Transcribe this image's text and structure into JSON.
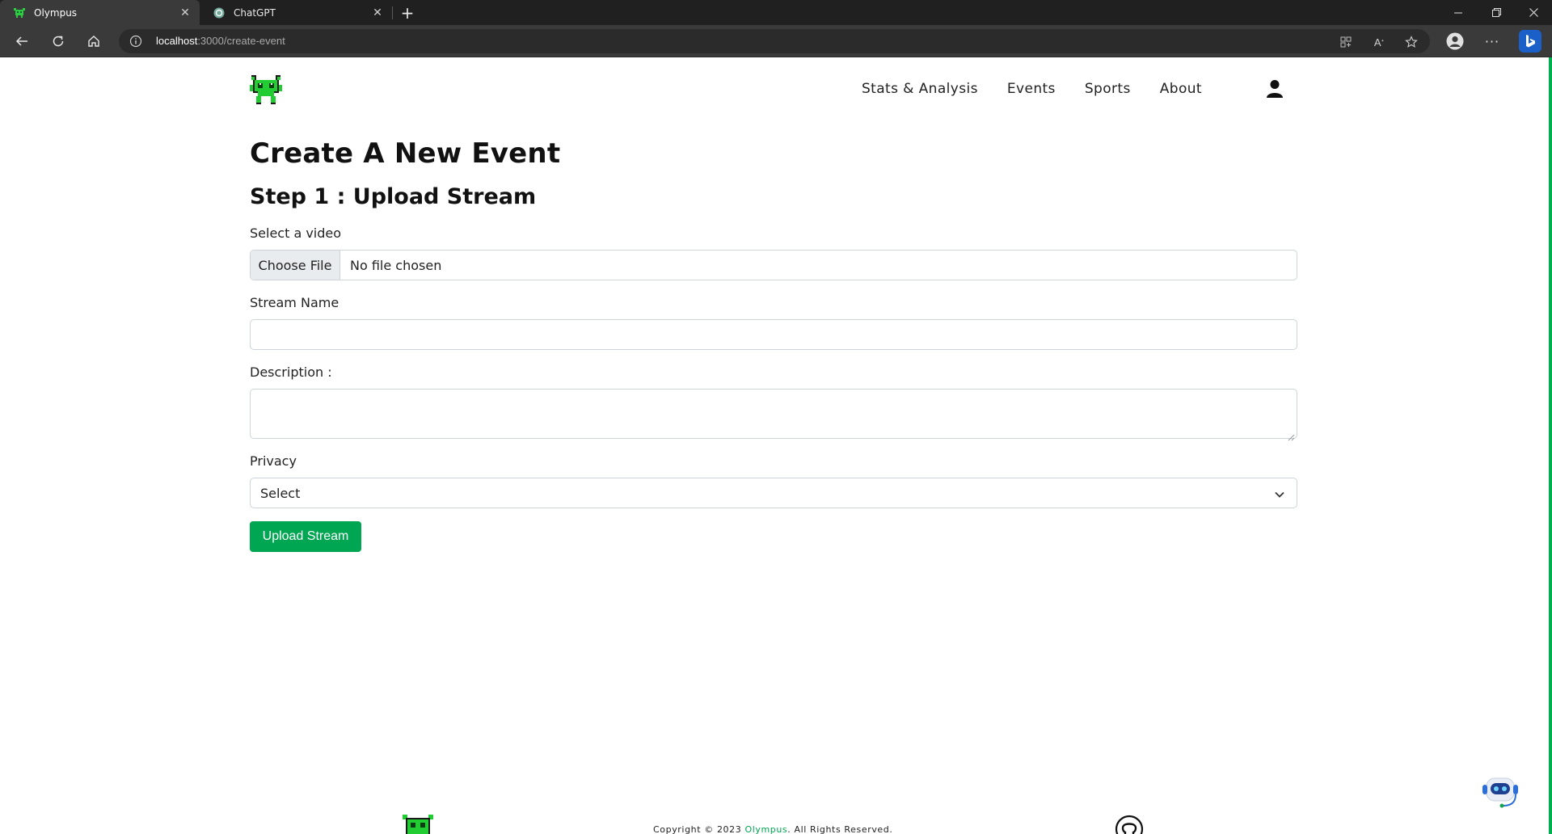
{
  "browser": {
    "tabs": [
      {
        "title": "Olympus",
        "active": true,
        "icon": "olympus-icon"
      },
      {
        "title": "ChatGPT",
        "active": false,
        "icon": "chatgpt-icon"
      }
    ],
    "url_host": "localhost",
    "url_rest": ":3000/create-event"
  },
  "nav": {
    "links": [
      "Stats & Analysis",
      "Events",
      "Sports",
      "About"
    ],
    "user_icon": "user-icon"
  },
  "page": {
    "title": "Create A New Event",
    "step_title": "Step 1 : Upload Stream",
    "video_label": "Select a video",
    "choose_file_label": "Choose File",
    "file_status": "No file chosen",
    "stream_name_label": "Stream Name",
    "stream_name_value": "",
    "description_label": "Description :",
    "description_value": "",
    "privacy_label": "Privacy",
    "privacy_selected": "Select",
    "submit_label": "Upload Stream"
  },
  "footer": {
    "copyright_prefix": "Copyright © 2023 ",
    "brand": "Olympus",
    "copyright_suffix": ". All Rights Reserved."
  },
  "colors": {
    "accent": "#00a651",
    "brand_green": "#00b050",
    "chrome_dark": "#202020",
    "chrome_toolbar": "#3a3a3a"
  }
}
